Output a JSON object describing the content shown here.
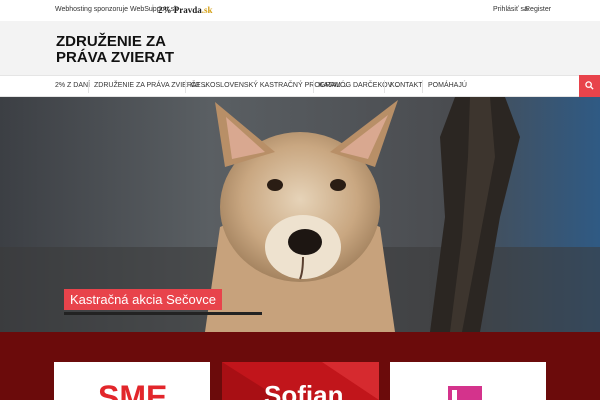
{
  "topbar": {
    "sponsor_text": "Webhosting sponzoruje WebSupport.sk",
    "separator": "|",
    "pravda_main": "2% Pravda",
    "pravda_suffix": ".sk",
    "login": "Prihlásiť sa",
    "register": "Register"
  },
  "header": {
    "title_line1": "ZDRUŽENIE ZA",
    "title_line2": "PRÁVA ZVIERAT"
  },
  "nav": {
    "items": [
      {
        "label": "2% Z DANÍ",
        "has_dropdown": false
      },
      {
        "label": "ZDRUŽENIE ZA PRÁVA ZVIERAT",
        "has_dropdown": true
      },
      {
        "label": "ČESKOSLOVENSKÝ KASTRAČNÝ PROGRAM",
        "has_dropdown": true
      },
      {
        "label": "KATALÓG DARČEKOV",
        "has_dropdown": true
      },
      {
        "label": "KONTAKT",
        "has_dropdown": false
      },
      {
        "label": "POMÁHAJÚ",
        "has_dropdown": false
      }
    ],
    "search_icon": "search-icon"
  },
  "hero": {
    "caption": "Kastračná akcia Sečovce",
    "image": "photo of a stray dog"
  },
  "promo": {
    "card1_text": "SME",
    "card2_text": "Sofian"
  },
  "colors": {
    "accent": "#e8434b",
    "promo_bg": "#6b0b0b",
    "header_bg": "#f3f3f3"
  }
}
